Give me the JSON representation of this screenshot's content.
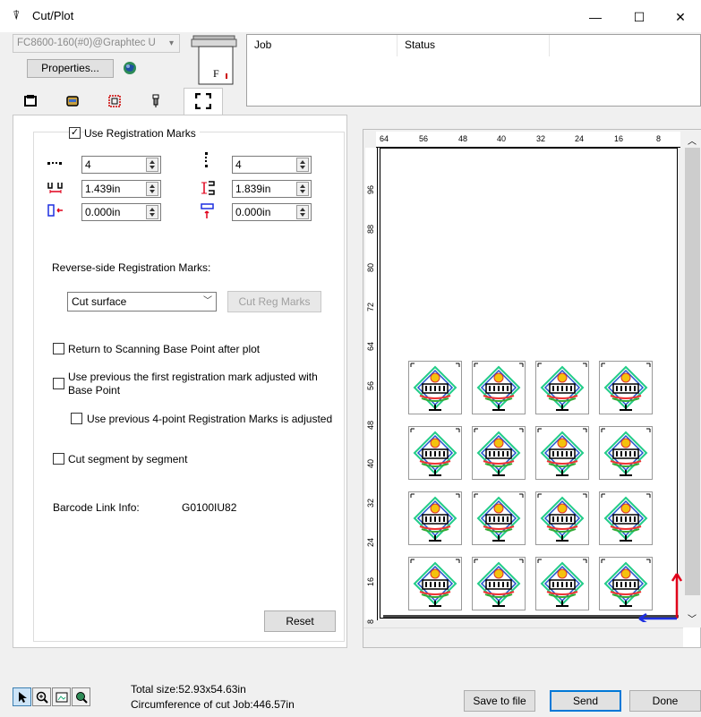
{
  "window": {
    "title": "Cut/Plot",
    "minimize": "—",
    "maximize": "☐",
    "close": "✕"
  },
  "device": {
    "selected": "FC8600-160(#0)@Graphtec U",
    "properties_label": "Properties..."
  },
  "job_table": {
    "headers": [
      "Job",
      "Status"
    ],
    "rows": []
  },
  "tabs": [
    {
      "name": "tab-general",
      "icon": "▣"
    },
    {
      "name": "tab-media",
      "icon": "⛁"
    },
    {
      "name": "tab-layout",
      "icon": "⛶"
    },
    {
      "name": "tab-tool",
      "icon": "⍒"
    },
    {
      "name": "tab-registration",
      "icon": "⛶"
    }
  ],
  "registration": {
    "use_registration_marks_label": "Use Registration Marks",
    "use_registration_marks_checked": true,
    "h_count": "4",
    "v_count": "4",
    "h_distance": "1.439in",
    "v_distance": "1.839in",
    "h_offset": "0.000in",
    "v_offset": "0.000in",
    "reverse_side_label": "Reverse-side Registration Marks:",
    "reverse_side_value": "Cut surface",
    "cut_reg_marks_label": "Cut Reg Marks",
    "return_label": "Return to Scanning Base Point after plot",
    "use_previous_label_1": "Use previous the first registration mark adjusted with",
    "use_previous_label_2": "Base Point",
    "use_previous_4pt_label": "Use previous 4-point Registration Marks is adjusted",
    "cut_segment_label": "Cut segment by segment",
    "barcode_label": "Barcode Link Info:",
    "barcode_value": "G0100IU82",
    "reset_label": "Reset"
  },
  "preview": {
    "ruler_x": [
      "64",
      "56",
      "48",
      "40",
      "32",
      "24",
      "16",
      "8"
    ],
    "ruler_y": [
      "96",
      "88",
      "80",
      "72",
      "64",
      "56",
      "48",
      "40",
      "32",
      "24",
      "16",
      "8"
    ]
  },
  "status": {
    "total_size": "Total size:52.93x54.63in",
    "circumference": "Circumference of cut Job:446.57in",
    "save_label": "Save to file",
    "send_label": "Send",
    "done_label": "Done"
  },
  "colors": {
    "accent": "#0078d7",
    "arrow_red": "#e0001a",
    "arrow_blue": "#1d2fe0"
  }
}
